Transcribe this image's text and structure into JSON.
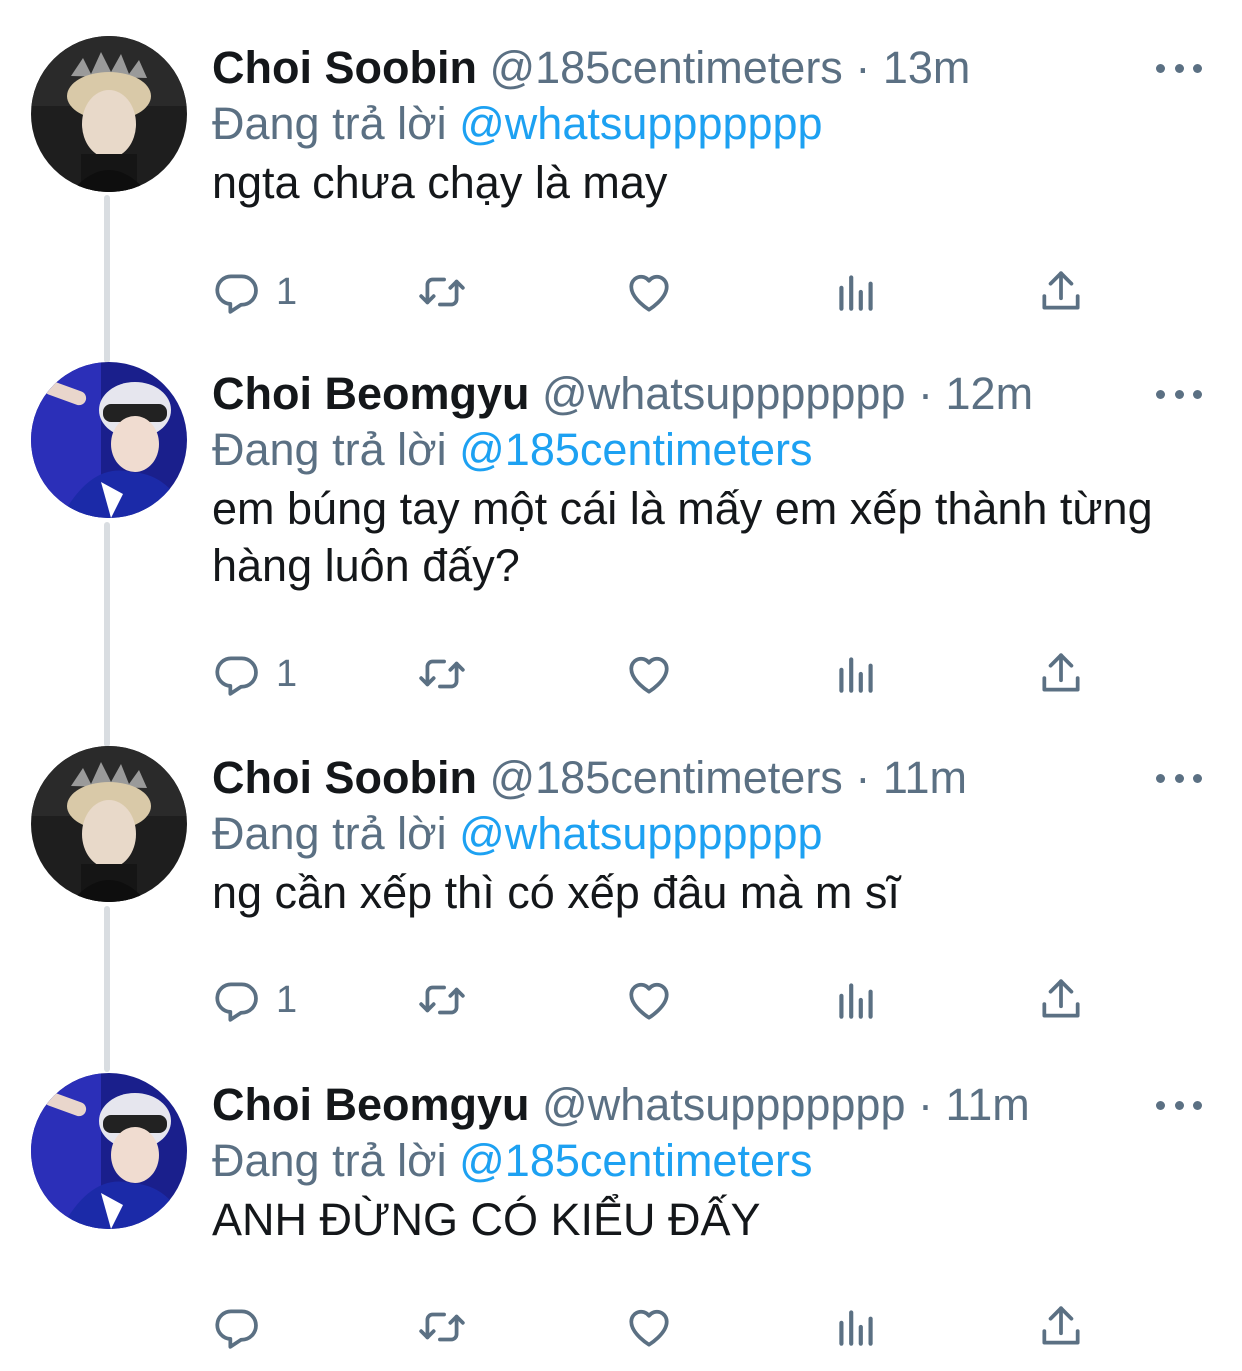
{
  "reply_prefix": "Đang trả lời",
  "tweets": [
    {
      "name": "Choi Soobin",
      "handle": "@185centimeters",
      "separator": "·",
      "time": "13m",
      "reply_to": "@whatsuppppppp",
      "text": "ngta chưa chạy là may",
      "reply_count": "1",
      "avatar": "soobin"
    },
    {
      "name": "Choi Beomgyu",
      "handle": "@whatsuppppppp",
      "separator": "·",
      "time": "12m",
      "reply_to": "@185centimeters",
      "text": "em búng tay một cái là mấy em xếp thành từng hàng luôn đấy?",
      "reply_count": "1",
      "avatar": "beomgyu"
    },
    {
      "name": "Choi Soobin",
      "handle": "@185centimeters",
      "separator": "·",
      "time": "11m",
      "reply_to": "@whatsuppppppp",
      "text": "ng cần xếp thì có xếp đâu mà m sĩ",
      "reply_count": "1",
      "avatar": "soobin"
    },
    {
      "name": "Choi Beomgyu",
      "handle": "@whatsuppppppp",
      "separator": "·",
      "time": "11m",
      "reply_to": "@185centimeters",
      "text": "ANH ĐỪNG CÓ KIỂU ĐẤY",
      "reply_count": "",
      "avatar": "beomgyu"
    }
  ],
  "icons": {
    "reply": "speech-bubble-icon",
    "retweet": "retweet-icon",
    "like": "heart-icon",
    "analytics": "bar-chart-icon",
    "share": "share-upload-icon",
    "more": "more-dots-icon"
  },
  "colors": {
    "link": "#1da1f2",
    "secondary": "#5b7083",
    "primary_text": "#14171a",
    "thread_line": "#d9dde1"
  }
}
